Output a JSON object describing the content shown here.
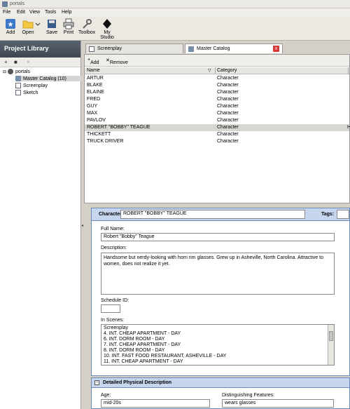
{
  "window": {
    "title": "portals"
  },
  "menu": [
    "File",
    "Edit",
    "View",
    "Tools",
    "Help"
  ],
  "toolbar": {
    "items": [
      {
        "label": "Add",
        "icon": "add-icon"
      },
      {
        "label": "Open",
        "icon": "folder-icon"
      },
      {
        "label": "Save",
        "icon": "save-icon"
      },
      {
        "label": "Print",
        "icon": "print-icon"
      },
      {
        "label": "Toolbox",
        "icon": "wrench-icon"
      },
      {
        "label": "My Studio",
        "icon": "studio-icon"
      }
    ]
  },
  "sidebar": {
    "title": "Project Library",
    "tree": [
      {
        "label": "portals",
        "icon": "project-icon"
      },
      {
        "label": "Master Catalog (10)",
        "icon": "catalog-icon"
      },
      {
        "label": "Screenplay",
        "icon": "screenplay-icon"
      },
      {
        "label": "Sketch",
        "icon": "sketch-icon"
      }
    ]
  },
  "tabs": [
    {
      "label": "Screenplay"
    },
    {
      "label": "Master Catalog",
      "close": "x"
    }
  ],
  "list": {
    "add_label": "Add",
    "remove_label": "Remove",
    "columns": [
      "Name",
      "Category"
    ],
    "rows": [
      {
        "name": "ARTUR",
        "category": "Character"
      },
      {
        "name": "BLAKE",
        "category": "Character"
      },
      {
        "name": "ELAINE",
        "category": "Character"
      },
      {
        "name": "FRED",
        "category": "Character"
      },
      {
        "name": "GUY",
        "category": "Character"
      },
      {
        "name": "MAX",
        "category": "Character"
      },
      {
        "name": "PAVLOV",
        "category": "Character"
      },
      {
        "name": "ROBERT \"BOBBY\" TEAGUE",
        "category": "Character",
        "extra": "H"
      },
      {
        "name": "THICKETT",
        "category": "Character"
      },
      {
        "name": "TRUCK DRIVER",
        "category": "Character"
      }
    ]
  },
  "detail": {
    "character_label": "Character:",
    "character_value": "ROBERT \"BOBBY\" TEAGUE",
    "tags_label": "Tags:",
    "full_name_label": "Full Name:",
    "full_name_value": "Robert \"Bobby\" Teague",
    "description_label": "Description:",
    "description_value": "Handsome but nerdy-looking with horn rim glasses. Grew up in Asheville, North Carolina.  Attractive to women, does not realize it yet.",
    "schedule_label": "Schedule ID:",
    "schedule_value": "",
    "scenes_label": "In Scenes:",
    "scenes": [
      "Screenplay",
      "4. INT. CHEAP APARTMENT - DAY",
      "6. INT. DORM ROOM - DAY",
      "7. INT. CHEAP APARTMENT - DAY",
      "8. INT. DORM ROOM - DAY",
      "10. INT. FAST FOOD RESTAURANT, ASHEVILLE - DAY",
      "11. INT. CHEAP APARTMENT - DAY"
    ],
    "physical_title": "Detailed Physical Description",
    "age_label": "Age:",
    "age_value": "mid-20s",
    "features_label": "Distinguishing Features:",
    "features_value": "wears glasses"
  }
}
